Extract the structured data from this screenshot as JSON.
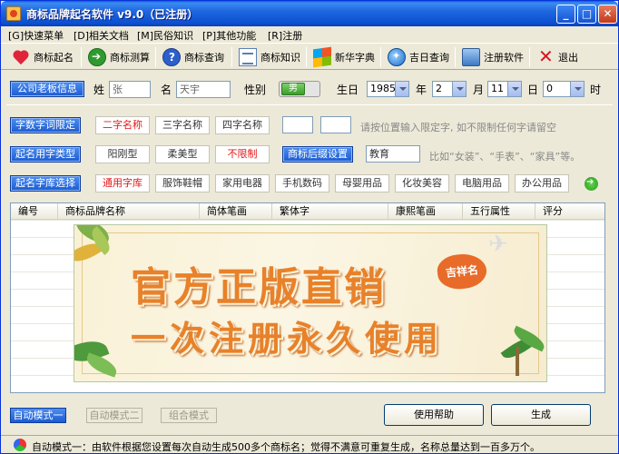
{
  "window": {
    "title": "商标品牌起名软件 v9.0（已注册）",
    "minimize": "_",
    "maximize": "□",
    "close": "✕"
  },
  "menu": [
    {
      "label": "[G]快速菜单"
    },
    {
      "label": "[D]相关文档"
    },
    {
      "label": "[M]民俗知识"
    },
    {
      "label": "[P]其他功能"
    },
    {
      "label": "[R]注册"
    }
  ],
  "toolbar": [
    {
      "label": "商标起名",
      "icon": "heart-icon"
    },
    {
      "label": "商标测算",
      "icon": "arrow-circle-icon"
    },
    {
      "label": "商标查询",
      "icon": "help-icon"
    },
    {
      "label": "商标知识",
      "icon": "document-icon"
    },
    {
      "label": "新华字典",
      "icon": "windows-icon"
    },
    {
      "label": "吉日查询",
      "icon": "globe-icon"
    },
    {
      "label": "注册软件",
      "icon": "register-icon"
    },
    {
      "label": "退出",
      "icon": "exit-icon"
    }
  ],
  "owner": {
    "button": "公司老板信息",
    "surname_label": "姓",
    "surname_value": "张",
    "given_label": "名",
    "given_value": "天宇",
    "gender_label": "性别",
    "gender_value": "男",
    "birth_label": "生日",
    "year": "1985",
    "year_unit": "年",
    "month": "2",
    "month_unit": "月",
    "day": "11",
    "day_unit": "日",
    "hour": "0",
    "hour_unit": "时"
  },
  "position_row": {
    "button": "字数字词限定",
    "options": [
      "二字名称",
      "三字名称",
      "四字名称"
    ],
    "hint": "请按位置输入限定字, 如不限制任何字请留空"
  },
  "type_row": {
    "button": "起名用字类型",
    "options": [
      "阳刚型",
      "柔美型",
      "不限制"
    ],
    "suffix_button": "商标后缀设置",
    "suffix_value": "教育",
    "hint": "比如“女装”、“手表”、“家具”等。"
  },
  "library_row": {
    "button": "起名字库选择",
    "options": [
      "通用字库",
      "服饰鞋帽",
      "家用电器",
      "手机数码",
      "母婴用品",
      "化妆美容",
      "电脑用品",
      "办公用品"
    ]
  },
  "table": {
    "columns": [
      "编号",
      "商标品牌名称",
      "简体笔画",
      "繁体字",
      "康熙笔画",
      "五行属性",
      "评分"
    ]
  },
  "banner": {
    "line1": "官方正版直销",
    "line2": "一次注册永久使用",
    "seal": "吉祥名"
  },
  "modes": [
    "自动模式一",
    "自动模式二",
    "组合模式"
  ],
  "actions": {
    "help": "使用帮助",
    "generate": "生成"
  },
  "status": {
    "text": "自动模式一：由软件根据您设置每次自动生成500多个商标名；觉得不满意可重复生成，名称总量达到一百多万个。"
  },
  "colors": {
    "title_bar": "#1f67e0",
    "button_blue": "#1b5bd2",
    "highlight_red": "#e21818",
    "banner_text": "#e8812a"
  }
}
